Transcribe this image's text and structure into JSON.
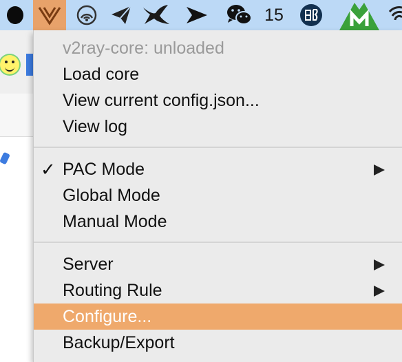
{
  "menubar": {
    "badge_count": "15",
    "icons": [
      "circle-app-icon",
      "v2ray-icon",
      "signal-icon",
      "paper-plane-icon",
      "swift-bird-icon",
      "arrow-icon",
      "wechat-icon",
      "dict-icon",
      "m-app-icon",
      "wifi-icon"
    ],
    "colors": {
      "bar": "#bcd9f6",
      "active": "#e8a26a",
      "mapp": "#3aa13a",
      "dict": "#12304f"
    }
  },
  "menu": {
    "status": "v2ray-core: unloaded",
    "load_core": "Load core",
    "view_config": "View current config.json...",
    "view_log": "View log",
    "pac_mode": "PAC Mode",
    "pac_checkmark": "✓",
    "global_mode": "Global Mode",
    "manual_mode": "Manual Mode",
    "server": "Server",
    "routing_rule": "Routing Rule",
    "configure": "Configure...",
    "backup_export": "Backup/Export",
    "highlight_color": "#efa96c"
  }
}
